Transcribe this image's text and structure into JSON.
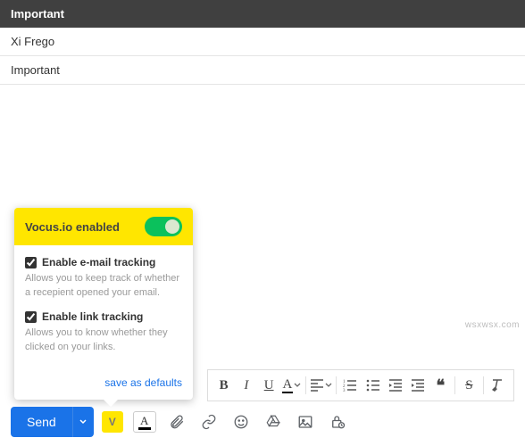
{
  "header": {
    "title": "Important"
  },
  "fields": {
    "to": "Xi Frego",
    "subject": "Important"
  },
  "popup": {
    "title": "Vocus.io enabled",
    "toggle_on": true,
    "options": [
      {
        "label": "Enable e-mail tracking",
        "desc": "Allows you to keep track of whether a recepient opened your email.",
        "checked": true
      },
      {
        "label": "Enable link tracking",
        "desc": "Allows you to know whether they clicked on your links.",
        "checked": true
      }
    ],
    "save_link": "save as defaults"
  },
  "format": {
    "bold": "B",
    "italic": "I",
    "underline": "U",
    "color": "A",
    "quote": "❝"
  },
  "bottombar": {
    "send": "Send",
    "vocus_badge": "V",
    "text_color": "A"
  },
  "watermark": "wsxwsx.com"
}
